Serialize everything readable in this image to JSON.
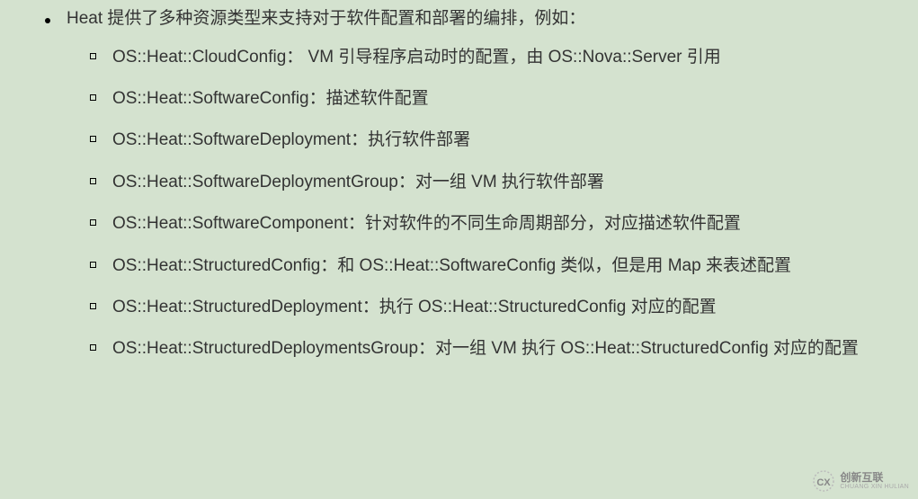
{
  "main_bullet": "Heat 提供了多种资源类型来支持对于软件配置和部署的编排，例如：",
  "sub_items": [
    "OS::Heat::CloudConfig：   VM 引导程序启动时的配置，由 OS::Nova::Server 引用",
    "OS::Heat::SoftwareConfig：描述软件配置",
    "OS::Heat::SoftwareDeployment：执行软件部署",
    "OS::Heat::SoftwareDeploymentGroup：对一组 VM 执行软件部署",
    "OS::Heat::SoftwareComponent：针对软件的不同生命周期部分，对应描述软件配置",
    "OS::Heat::StructuredConfig：和 OS::Heat::SoftwareConfig 类似，但是用 Map 来表述配置",
    "OS::Heat::StructuredDeployment：执行 OS::Heat::StructuredConfig 对应的配置",
    "OS::Heat::StructuredDeploymentsGroup：对一组 VM 执行 OS::Heat::StructuredConfig 对应的配置"
  ],
  "watermark": {
    "cn": "创新互联",
    "en": "CHUANG XIN HULIAN"
  }
}
